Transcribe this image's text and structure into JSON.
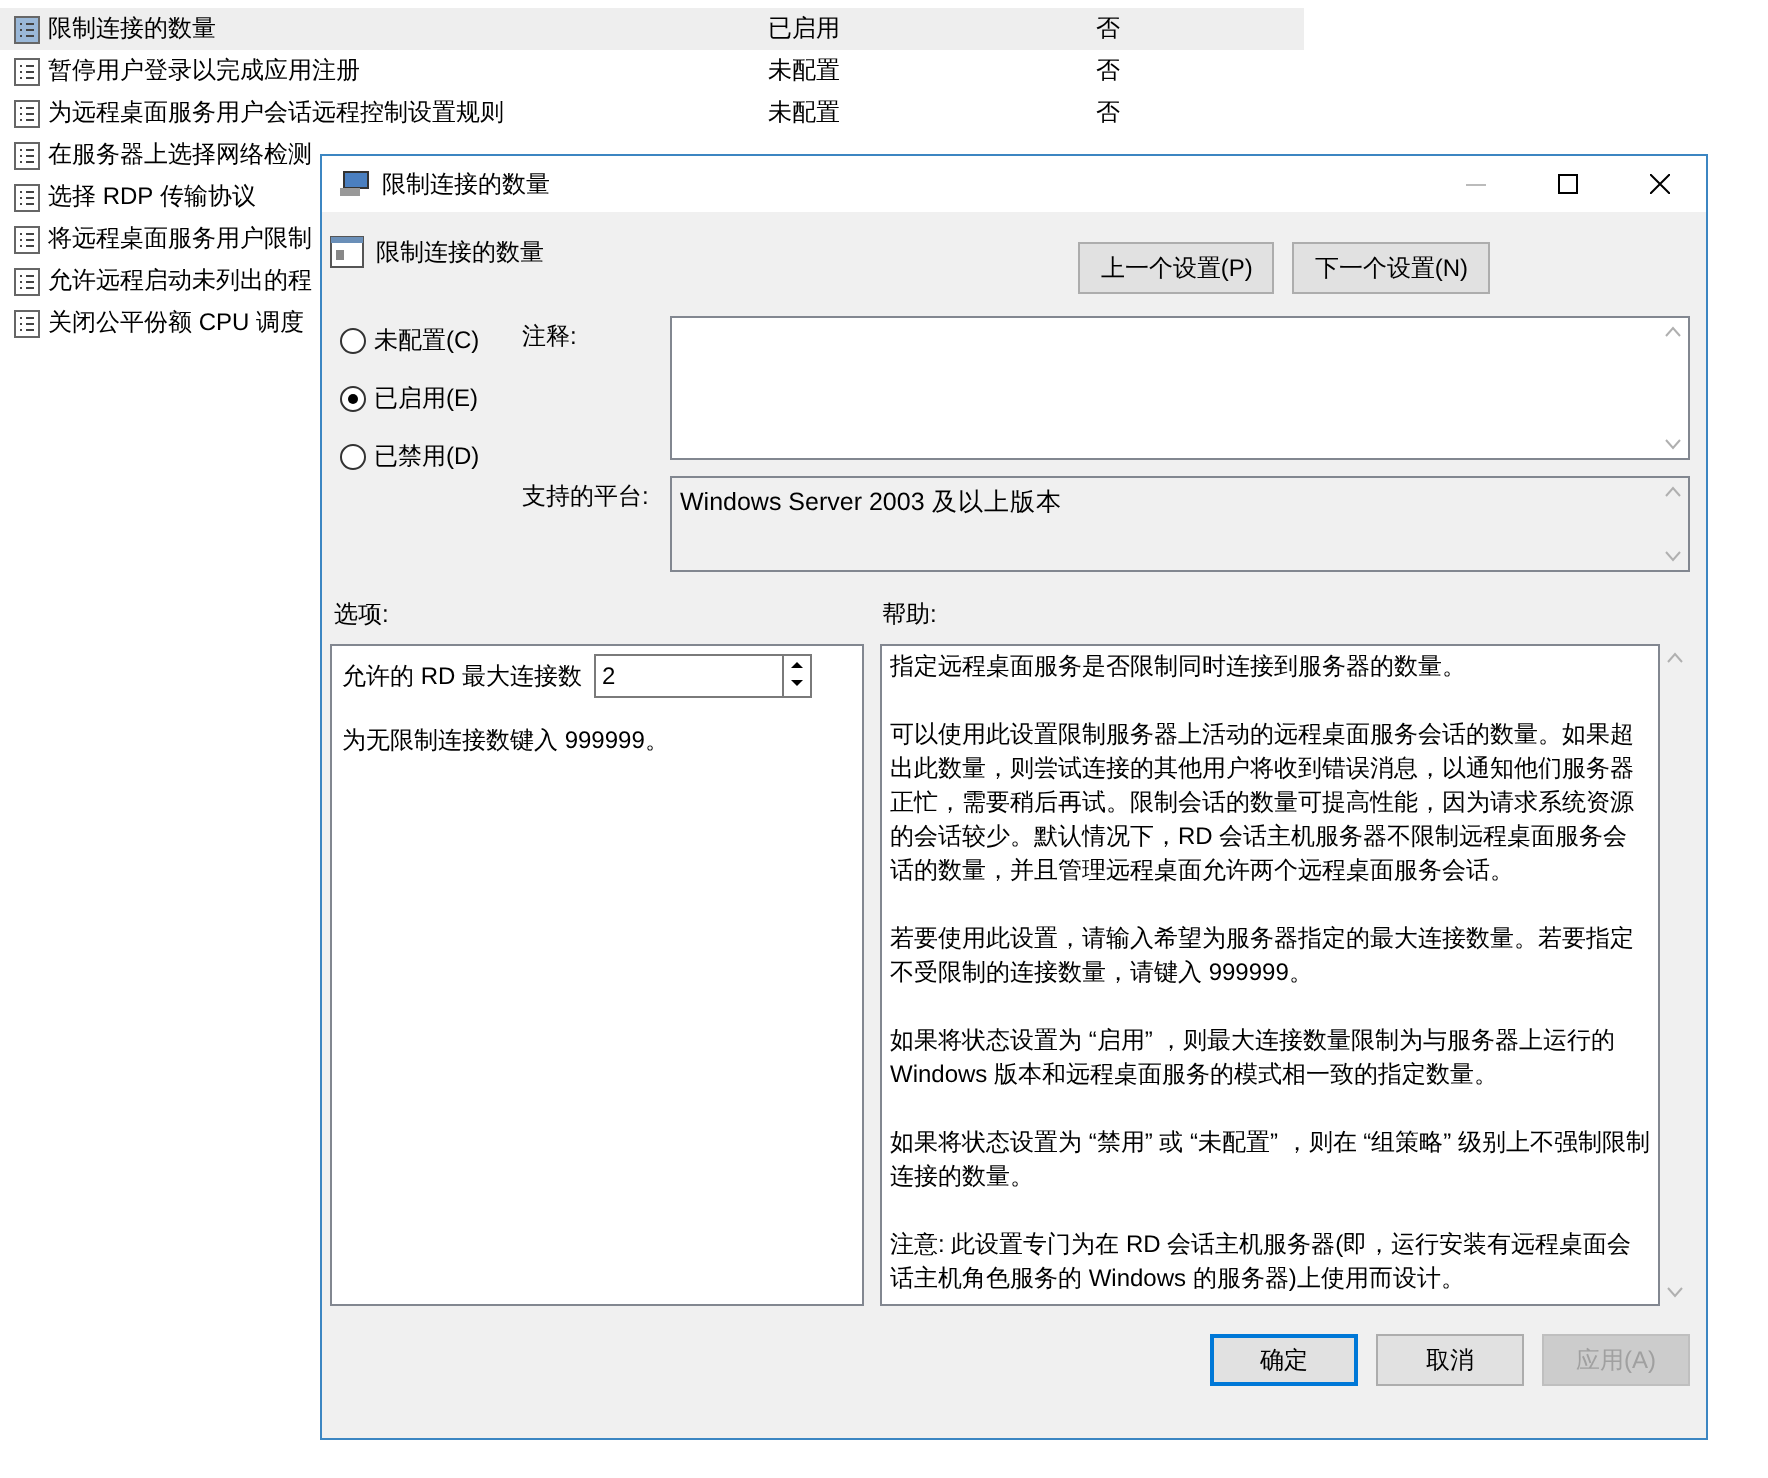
{
  "policy_list": {
    "rows": [
      {
        "name": "限制连接的数量",
        "state": "已启用",
        "comment": "否",
        "selected": true
      },
      {
        "name": "暂停用户登录以完成应用注册",
        "state": "未配置",
        "comment": "否",
        "selected": false
      },
      {
        "name": "为远程桌面服务用户会话远程控制设置规则",
        "state": "未配置",
        "comment": "否",
        "selected": false
      },
      {
        "name": "在服务器上选择网络检测",
        "selected": false
      },
      {
        "name": "选择 RDP 传输协议",
        "selected": false
      },
      {
        "name": "将远程桌面服务用户限制",
        "selected": false
      },
      {
        "name": "允许远程启动未列出的程",
        "selected": false
      },
      {
        "name": "关闭公平份额 CPU 调度",
        "selected": false
      }
    ]
  },
  "dialog": {
    "title": "限制连接的数量",
    "setting_title": "限制连接的数量",
    "nav_buttons": [
      "上一个设置(P)",
      "下一个设置(N)"
    ],
    "states": [
      {
        "label": "未配置(C)",
        "selected": false
      },
      {
        "label": "已启用(E)",
        "selected": true
      },
      {
        "label": "已禁用(D)",
        "selected": false
      }
    ],
    "comment": {
      "label": "注释:"
    },
    "platform": {
      "label": "支持的平台:",
      "value": "Windows Server 2003 及以上版本"
    },
    "options_label": "选项:",
    "help_label": "帮助:",
    "option_field": {
      "label": "允许的 RD 最大连接数",
      "value": "2"
    },
    "option_hint": "为无限制连接数键入 999999。",
    "help_paragraphs": [
      "指定远程桌面服务是否限制同时连接到服务器的数量。",
      "可以使用此设置限制服务器上活动的远程桌面服务会话的数量。如果超出此数量，则尝试连接的其他用户将收到错误消息，以通知他们服务器正忙，需要稍后再试。限制会话的数量可提高性能，因为请求系统资源的会话较少。默认情况下，RD 会话主机服务器不限制远程桌面服务会话的数量，并且管理远程桌面允许两个远程桌面服务会话。",
      "若要使用此设置，请输入希望为服务器指定的最大连接数量。若要指定不受限制的连接数量，请键入 999999。",
      "如果将状态设置为 “启用” ，则最大连接数量限制为与服务器上运行的 Windows 版本和远程桌面服务的模式相一致的指定数量。",
      "如果将状态设置为 “禁用” 或 “未配置” ，则在 “组策略” 级别上不强制限制连接的数量。",
      "注意: 此设置专门为在 RD 会话主机服务器(即，运行安装有远程桌面会话主机角色服务的 Windows 的服务器)上使用而设计。"
    ],
    "buttons": [
      {
        "label": "确定",
        "default": true,
        "disabled": false
      },
      {
        "label": "取消",
        "default": false,
        "disabled": false
      },
      {
        "label": "应用(A)",
        "default": false,
        "disabled": true
      }
    ]
  }
}
